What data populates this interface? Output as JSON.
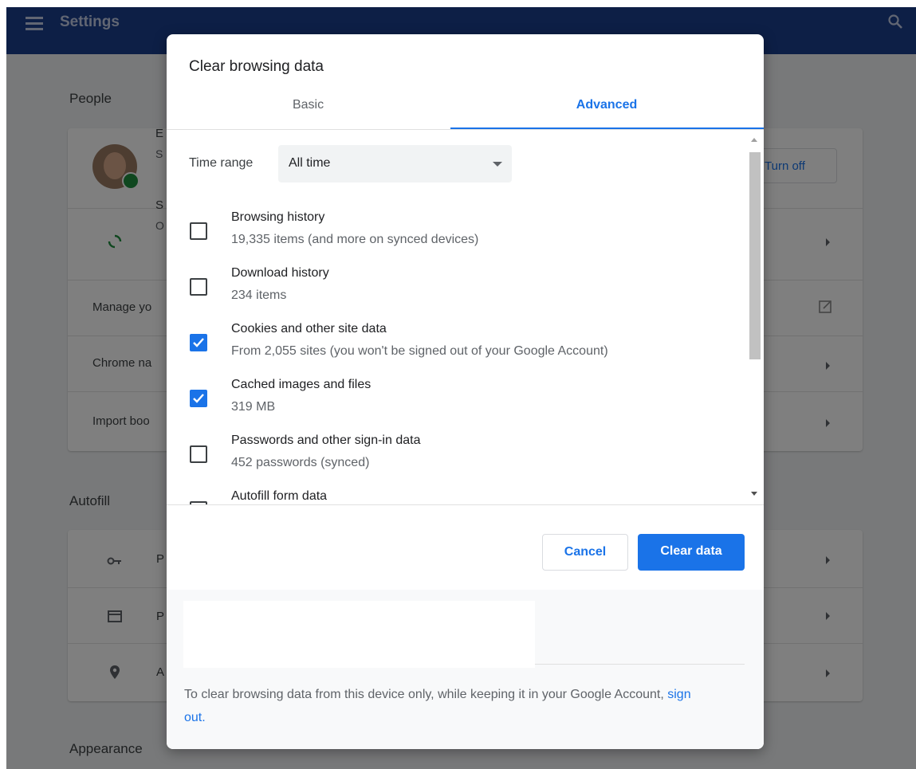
{
  "app": {
    "title": "Settings"
  },
  "background": {
    "people_title": "People",
    "account_initial": "E",
    "account_sub_initial": "S",
    "sync_initial": "S",
    "sync_sub_initial": "O",
    "turn_off_label": "Turn off",
    "rows": [
      {
        "label": "Manage yo"
      },
      {
        "label": "Chrome na"
      },
      {
        "label": "Import boo"
      }
    ],
    "autofill_title": "Autofill",
    "autofill_rows": [
      {
        "initial": "P",
        "icon": "key-icon"
      },
      {
        "initial": "P",
        "icon": "credit-card-icon"
      },
      {
        "initial": "A",
        "icon": "location-pin-icon"
      }
    ],
    "appearance_title": "Appearance"
  },
  "dialog": {
    "title": "Clear browsing data",
    "tabs": [
      {
        "label": "Basic",
        "selected": false
      },
      {
        "label": "Advanced",
        "selected": true
      }
    ],
    "time_range": {
      "label": "Time range",
      "value": "All time"
    },
    "items": [
      {
        "label": "Browsing history",
        "sub": "19,335 items (and more on synced devices)",
        "checked": false
      },
      {
        "label": "Download history",
        "sub": "234 items",
        "checked": false
      },
      {
        "label": "Cookies and other site data",
        "sub": "From 2,055 sites (you won't be signed out of your Google Account)",
        "checked": true
      },
      {
        "label": "Cached images and files",
        "sub": "319 MB",
        "checked": true
      },
      {
        "label": "Passwords and other sign-in data",
        "sub": "452 passwords (synced)",
        "checked": false
      },
      {
        "label": "Autofill form data",
        "sub": "",
        "checked": false
      }
    ],
    "cancel_label": "Cancel",
    "clear_label": "Clear data",
    "footer_text": "To clear browsing data from this device only, while keeping it in your Google Account,",
    "footer_link": "sign out."
  },
  "colors": {
    "accent": "#1a73e8",
    "topbar": "#1a3e8c"
  }
}
